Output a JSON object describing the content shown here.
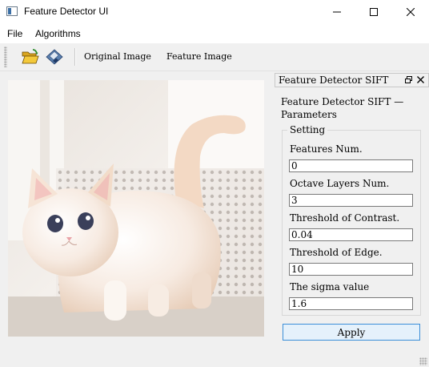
{
  "window": {
    "title": "Feature Detector UI",
    "controls": [
      "minimize-icon",
      "maximize-icon",
      "close-icon"
    ]
  },
  "menu": {
    "items": [
      {
        "label": "File"
      },
      {
        "label": "Algorithms"
      }
    ]
  },
  "toolbar": {
    "icons": [
      "open-folder-icon",
      "save-disk-icon"
    ],
    "buttons": [
      {
        "label": "Original Image"
      },
      {
        "label": "Feature Image"
      }
    ]
  },
  "image": {
    "description_icon": "cat-photo"
  },
  "dock": {
    "title": "Feature Detector SIFT",
    "heading": "Feature Detector SIFT — Parameters",
    "group_title": "Setting",
    "fields": [
      {
        "label": "Features Num.",
        "value": "0"
      },
      {
        "label": "Octave Layers Num.",
        "value": "3"
      },
      {
        "label": "Threshold of Contrast.",
        "value": "0.04"
      },
      {
        "label": "Threshold of Edge.",
        "value": "10"
      },
      {
        "label": "The sigma value",
        "value": "1.6"
      }
    ],
    "apply_label": "Apply"
  },
  "colors": {
    "apply_border": "#3c8fd8",
    "apply_bg": "#e5f1fb",
    "window_bg": "#f0f0f0"
  }
}
